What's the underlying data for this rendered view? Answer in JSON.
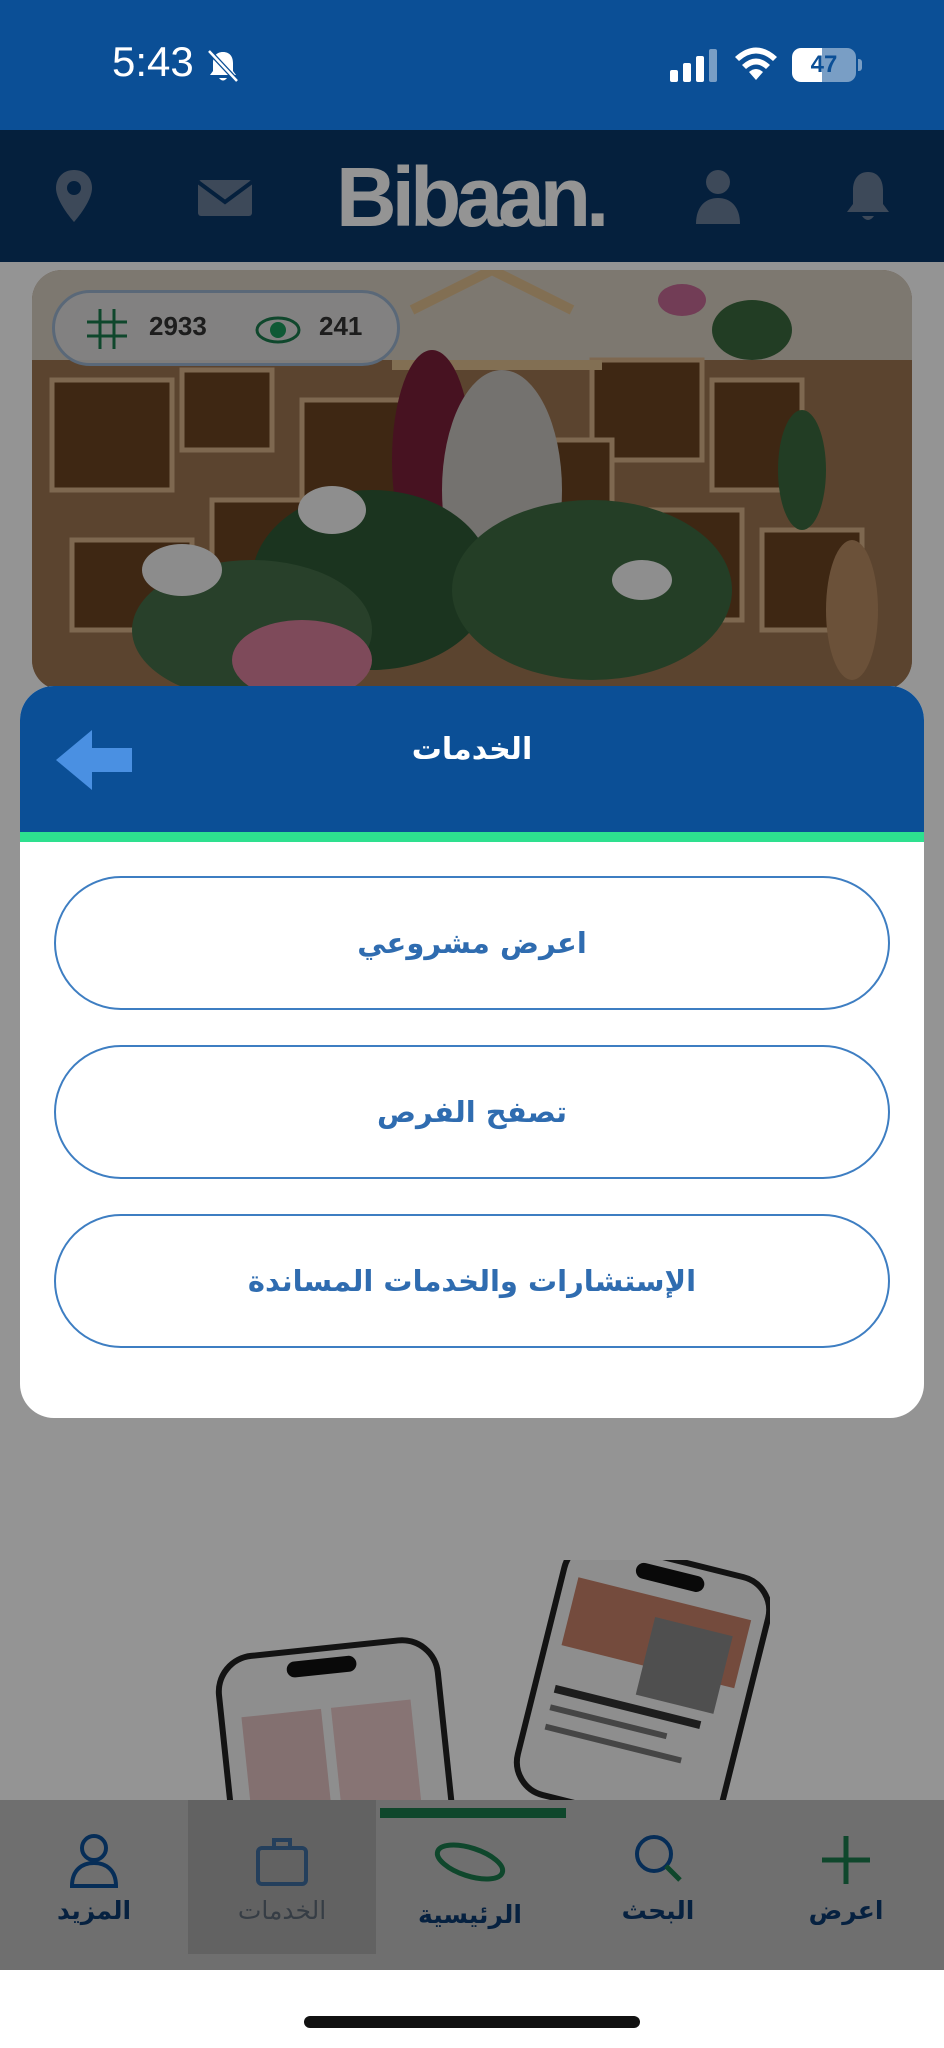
{
  "status_bar": {
    "time": "5:43",
    "battery": "47",
    "battery_level": 0.47,
    "icons": [
      "bell-slash-icon",
      "cellular-signal-icon",
      "wifi-icon",
      "battery-icon"
    ]
  },
  "header": {
    "logo": "Bibaan.",
    "icons": [
      "location-pin-icon",
      "mail-icon",
      "user-icon",
      "bell-icon"
    ]
  },
  "hero": {
    "count_label": "2933",
    "views_label": "241"
  },
  "modal": {
    "title": "الخدمات",
    "back_icon": "arrow-left-icon",
    "options": [
      {
        "label": "اعرض مشروعي"
      },
      {
        "label": "تصفح الفرص"
      },
      {
        "label": "الإستشارات والخدمات المساندة"
      }
    ]
  },
  "bottom_nav": {
    "items": [
      {
        "label": "المزيد",
        "icon": "person-icon"
      },
      {
        "label": "الخدمات",
        "icon": "briefcase-icon"
      },
      {
        "label": "الرئيسية",
        "icon": "home-ring-icon"
      },
      {
        "label": "البحث",
        "icon": "search-icon"
      },
      {
        "label": "اعرض",
        "icon": "plus-icon"
      }
    ],
    "active_index": 2
  },
  "colors": {
    "primary": "#0b4f96",
    "header_dark": "#09376a",
    "accent_green": "#2ee08f",
    "button_text": "#2f6cb0"
  }
}
